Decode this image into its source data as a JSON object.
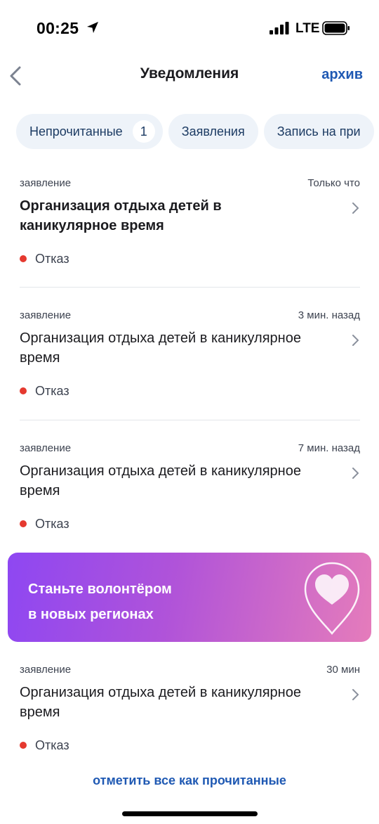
{
  "status_bar": {
    "time": "00:25",
    "network": "LTE"
  },
  "nav": {
    "title": "Уведомления",
    "archive_label": "архив",
    "back_icon": "chevron-left-icon"
  },
  "filters": [
    {
      "label": "Непрочитанные",
      "count": "1"
    },
    {
      "label": "Заявления"
    },
    {
      "label": "Запись на при"
    }
  ],
  "notifications": [
    {
      "type": "заявление",
      "time": "Только что",
      "title": "Организация отдыха детей в каникулярное время",
      "status": "Отказ",
      "unread": true
    },
    {
      "type": "заявление",
      "time": "3 мин. назад",
      "title": "Организация отдыха детей в каникулярное время",
      "status": "Отказ",
      "unread": false
    },
    {
      "type": "заявление",
      "time": "7 мин. назад",
      "title": "Организация отдыха детей в каникулярное время",
      "status": "Отказ",
      "unread": false
    },
    {
      "type": "заявление",
      "time": "30 мин",
      "title": "Организация отдыха детей в каникулярное время",
      "status": "Отказ",
      "unread": false
    }
  ],
  "banner": {
    "line1": "Станьте волонтёром",
    "line2": "в новых регионах",
    "icon": "heart-pin-icon"
  },
  "footer": {
    "mark_all_label": "отметить все как прочитанные"
  },
  "colors": {
    "accent": "#1f59b3",
    "status_reject": "#e5392f",
    "chip_bg": "#eef3f9"
  }
}
